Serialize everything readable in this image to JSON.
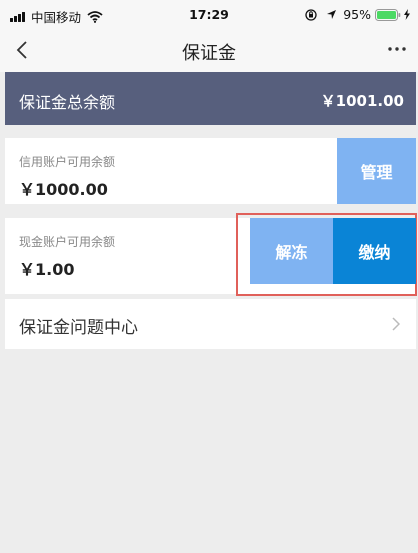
{
  "status_bar": {
    "carrier": "中国移动",
    "time": "17:29",
    "battery": "95%"
  },
  "nav": {
    "title": "保证金"
  },
  "total": {
    "label": "保证金总余额",
    "amount": "￥1001.00"
  },
  "credit_account": {
    "label": "信用账户可用余额",
    "amount": "￥1000.00",
    "manage_label": "管理"
  },
  "cash_account": {
    "label": "现金账户可用余额",
    "amount": "￥1.00",
    "unfreeze_label": "解冻",
    "pay_label": "缴纳"
  },
  "faq": {
    "label": "保证金问题中心"
  },
  "colors": {
    "banner": "#575f7d",
    "button_light": "#7fb3f2",
    "button_primary": "#0a84d6",
    "highlight": "#e0605a",
    "battery": "#4cd964"
  }
}
